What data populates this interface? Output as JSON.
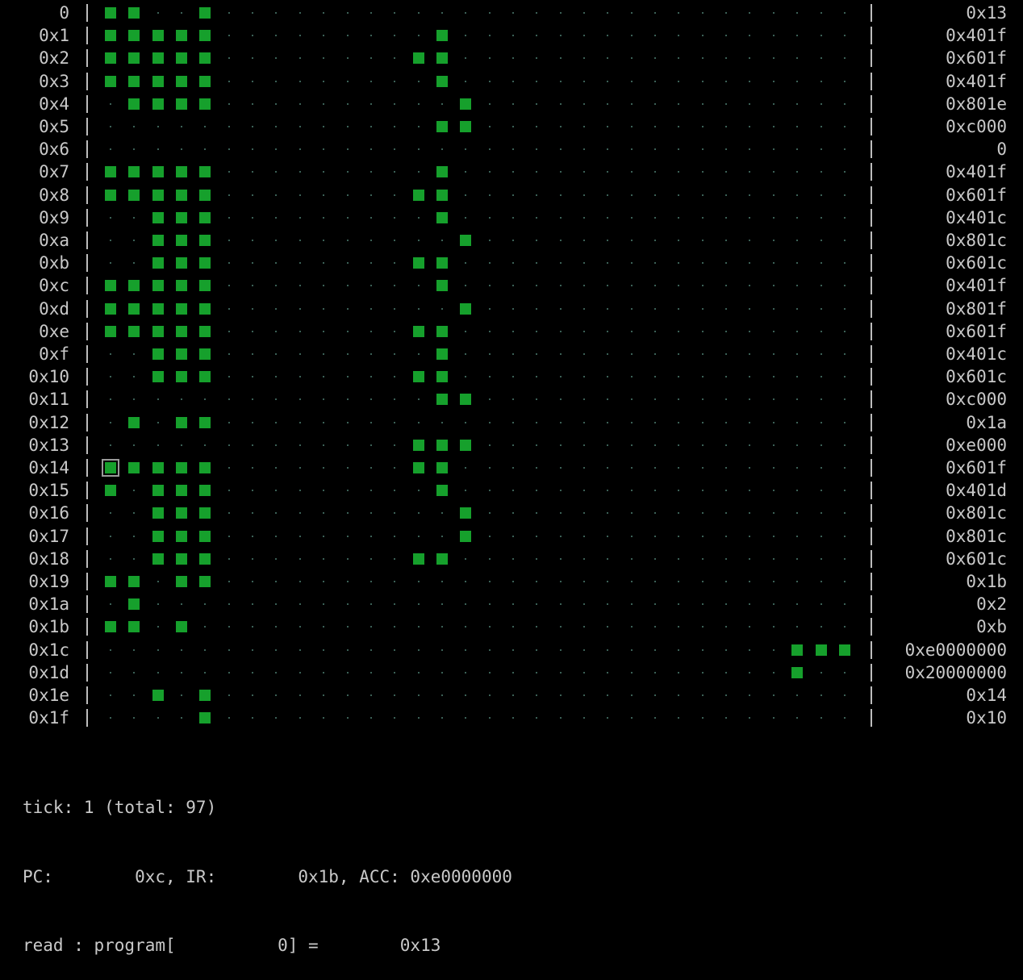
{
  "memory": {
    "bits_per_word": 32,
    "cursor_address": "0x14",
    "cursor_bit": 0,
    "words": [
      {
        "addr": "0",
        "bits": "11001000000000000000000000000000",
        "value": "0x13"
      },
      {
        "addr": "0x1",
        "bits": "11111000000000000000000000000000",
        "value": "0x401f"
      },
      {
        "addr": "0x2",
        "bits": "11111000000000000000000000000000",
        "value": "0x601f"
      },
      {
        "addr": "0x3",
        "bits": "11111000000000000000000000000000",
        "value": "0x401f"
      },
      {
        "addr": "0x4",
        "bits": "01111000000000000000000000000000",
        "value": "0x801e"
      },
      {
        "addr": "0x5",
        "bits": "00000000000000000000000000000000",
        "value": "0xc000"
      },
      {
        "addr": "0x6",
        "bits": "00000000000000000000000000000000",
        "value": "0"
      },
      {
        "addr": "0x7",
        "bits": "11111000000000000000000000000000",
        "value": "0x401f"
      },
      {
        "addr": "0x8",
        "bits": "11111000000000000000000000000000",
        "value": "0x601f"
      },
      {
        "addr": "0x9",
        "bits": "00111000000000000000000000000000",
        "value": "0x401c"
      },
      {
        "addr": "0xa",
        "bits": "00111000000000000000000000000000",
        "value": "0x801c"
      },
      {
        "addr": "0xb",
        "bits": "00111000000000000000000000000000",
        "value": "0x601c"
      },
      {
        "addr": "0xc",
        "bits": "11111000000000000000000000000000",
        "value": "0x401f"
      },
      {
        "addr": "0xd",
        "bits": "11111000000000000000000000000000",
        "value": "0x801f"
      },
      {
        "addr": "0xe",
        "bits": "11111000000000000000000000000000",
        "value": "0x601f"
      },
      {
        "addr": "0xf",
        "bits": "00111000000000000000000000000000",
        "value": "0x401c"
      },
      {
        "addr": "0x10",
        "bits": "00111000000000000000000000000000",
        "value": "0x601c"
      },
      {
        "addr": "0x11",
        "bits": "00000000000000000000000000000000",
        "value": "0xc000"
      },
      {
        "addr": "0x12",
        "bits": "01011000000000000000000000000000",
        "value": "0x1a"
      },
      {
        "addr": "0x13",
        "bits": "00000000000000000000000000000000",
        "value": "0xe000"
      },
      {
        "addr": "0x14",
        "bits": "11111000000000000000000000000000",
        "value": "0x601f"
      },
      {
        "addr": "0x15",
        "bits": "10111000000000000000000000000000",
        "value": "0x401d"
      },
      {
        "addr": "0x16",
        "bits": "00111000000000000000000000000000",
        "value": "0x801c"
      },
      {
        "addr": "0x17",
        "bits": "00111000000000000000000000000000",
        "value": "0x801c"
      },
      {
        "addr": "0x18",
        "bits": "00111000000000000000000000000000",
        "value": "0x601c"
      },
      {
        "addr": "0x19",
        "bits": "11011000000000000000000000000000",
        "value": "0x1b"
      },
      {
        "addr": "0x1a",
        "bits": "01000000000000000000000000000000",
        "value": "0x2"
      },
      {
        "addr": "0x1b",
        "bits": "11010000000000000000000000000000",
        "value": "0xb"
      },
      {
        "addr": "0x1c",
        "bits": "00000000000000000000000000000111",
        "value": "0xe0000000"
      },
      {
        "addr": "0x1d",
        "bits": "00000000000000000000000000000100",
        "value": "0x20000000"
      },
      {
        "addr": "0x1e",
        "bits": "00101000000000000000000000000000",
        "value": "0x14"
      },
      {
        "addr": "0x1f",
        "bits": "00001000000000000000000000000000",
        "value": "0x10"
      }
    ],
    "high_bits": [
      {
        "addr": "0x1",
        "bits": "0100"
      },
      {
        "addr": "0x2",
        "bits": "1100"
      },
      {
        "addr": "0x3",
        "bits": "0100"
      },
      {
        "addr": "0x4",
        "bits": "0010"
      },
      {
        "addr": "0x5",
        "bits": "0110"
      },
      {
        "addr": "0x7",
        "bits": "0100"
      },
      {
        "addr": "0x8",
        "bits": "1100"
      },
      {
        "addr": "0x9",
        "bits": "0100"
      },
      {
        "addr": "0xa",
        "bits": "0010"
      },
      {
        "addr": "0xb",
        "bits": "1100"
      },
      {
        "addr": "0xc",
        "bits": "0100"
      },
      {
        "addr": "0xd",
        "bits": "0010"
      },
      {
        "addr": "0xe",
        "bits": "1100"
      },
      {
        "addr": "0xf",
        "bits": "0100"
      },
      {
        "addr": "0x10",
        "bits": "1100"
      },
      {
        "addr": "0x11",
        "bits": "0110"
      },
      {
        "addr": "0x13",
        "bits": "1110"
      },
      {
        "addr": "0x14",
        "bits": "1100"
      },
      {
        "addr": "0x15",
        "bits": "0100"
      },
      {
        "addr": "0x16",
        "bits": "0010"
      },
      {
        "addr": "0x17",
        "bits": "0010"
      },
      {
        "addr": "0x18",
        "bits": "1100"
      }
    ],
    "colors": {
      "bit_on": "#16a02c",
      "bit_off_dot": "#4e7f72",
      "background": "#000000",
      "text": "#c9c9c9",
      "cursor": "#9a9a9a"
    }
  },
  "status": {
    "tick_line": "tick: 1 (total: 97)",
    "registers_line": "PC:        0xc, IR:        0x1b, ACC: 0xe0000000",
    "read_line": "read : program[          0] =        0x13"
  }
}
